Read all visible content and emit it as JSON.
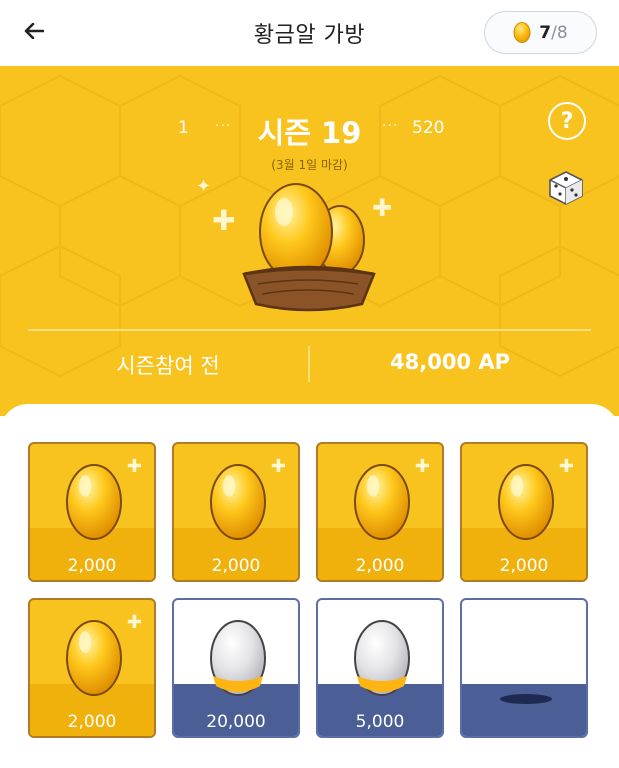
{
  "header": {
    "title": "황금알 가방",
    "back_icon": "arrow-left-icon",
    "egg_count": "7",
    "egg_max": "/8"
  },
  "season": {
    "min": "1",
    "title": "시즌 19",
    "max": "520",
    "deadline": "(3월 1일 마감)",
    "status": "시즌참여 전",
    "points": "48,000 AP"
  },
  "colors": {
    "gold": "#f8c21f",
    "gold_border": "#b07a26",
    "silver_border": "#5a6ea8",
    "platform_blue": "#4c5e96"
  },
  "tiles": [
    {
      "type": "gold",
      "value": "2,000"
    },
    {
      "type": "gold",
      "value": "2,000"
    },
    {
      "type": "gold",
      "value": "2,000"
    },
    {
      "type": "gold",
      "value": "2,000"
    },
    {
      "type": "gold",
      "value": "2,000"
    },
    {
      "type": "silver",
      "value": "20,000"
    },
    {
      "type": "silver",
      "value": "5,000"
    },
    {
      "type": "empty",
      "value": ""
    }
  ]
}
